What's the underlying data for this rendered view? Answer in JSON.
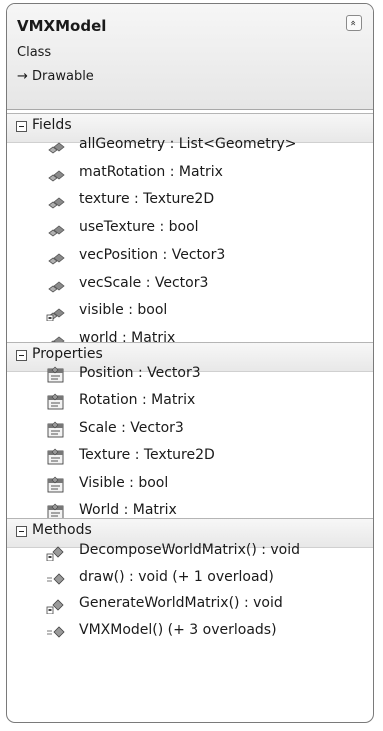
{
  "class": {
    "name": "VMXModel",
    "kind": "Class",
    "inherits": "→ Drawable",
    "collapse_glyph": "»"
  },
  "sections": [
    {
      "title": "Fields",
      "items": [
        {
          "label": "allGeometry : List<Geometry>",
          "icon": "private-field-icon"
        },
        {
          "label": "matRotation : Matrix",
          "icon": "private-field-icon"
        },
        {
          "label": "texture : Texture2D",
          "icon": "private-field-icon"
        },
        {
          "label": "useTexture : bool",
          "icon": "private-field-icon"
        },
        {
          "label": "vecPosition : Vector3",
          "icon": "private-field-icon"
        },
        {
          "label": "vecScale : Vector3",
          "icon": "private-field-icon"
        },
        {
          "label": "visible : bool",
          "icon": "protected-field-icon"
        },
        {
          "label": "world : Matrix",
          "icon": "private-field-icon"
        }
      ]
    },
    {
      "title": "Properties",
      "items": [
        {
          "label": "Position : Vector3",
          "icon": "property-icon"
        },
        {
          "label": "Rotation : Matrix",
          "icon": "property-icon"
        },
        {
          "label": "Scale : Vector3",
          "icon": "property-icon"
        },
        {
          "label": "Texture : Texture2D",
          "icon": "property-icon"
        },
        {
          "label": "Visible : bool",
          "icon": "property-icon"
        },
        {
          "label": "World : Matrix",
          "icon": "property-icon"
        }
      ]
    },
    {
      "title": "Methods",
      "items": [
        {
          "label": "DecomposeWorldMatrix() : void",
          "icon": "protected-method-icon"
        },
        {
          "label": "draw() : void (+ 1 overload)",
          "icon": "public-method-icon"
        },
        {
          "label": "GenerateWorldMatrix() : void",
          "icon": "protected-method-icon"
        },
        {
          "label": "VMXModel() (+ 3 overloads)",
          "icon": "public-method-icon"
        }
      ]
    }
  ]
}
